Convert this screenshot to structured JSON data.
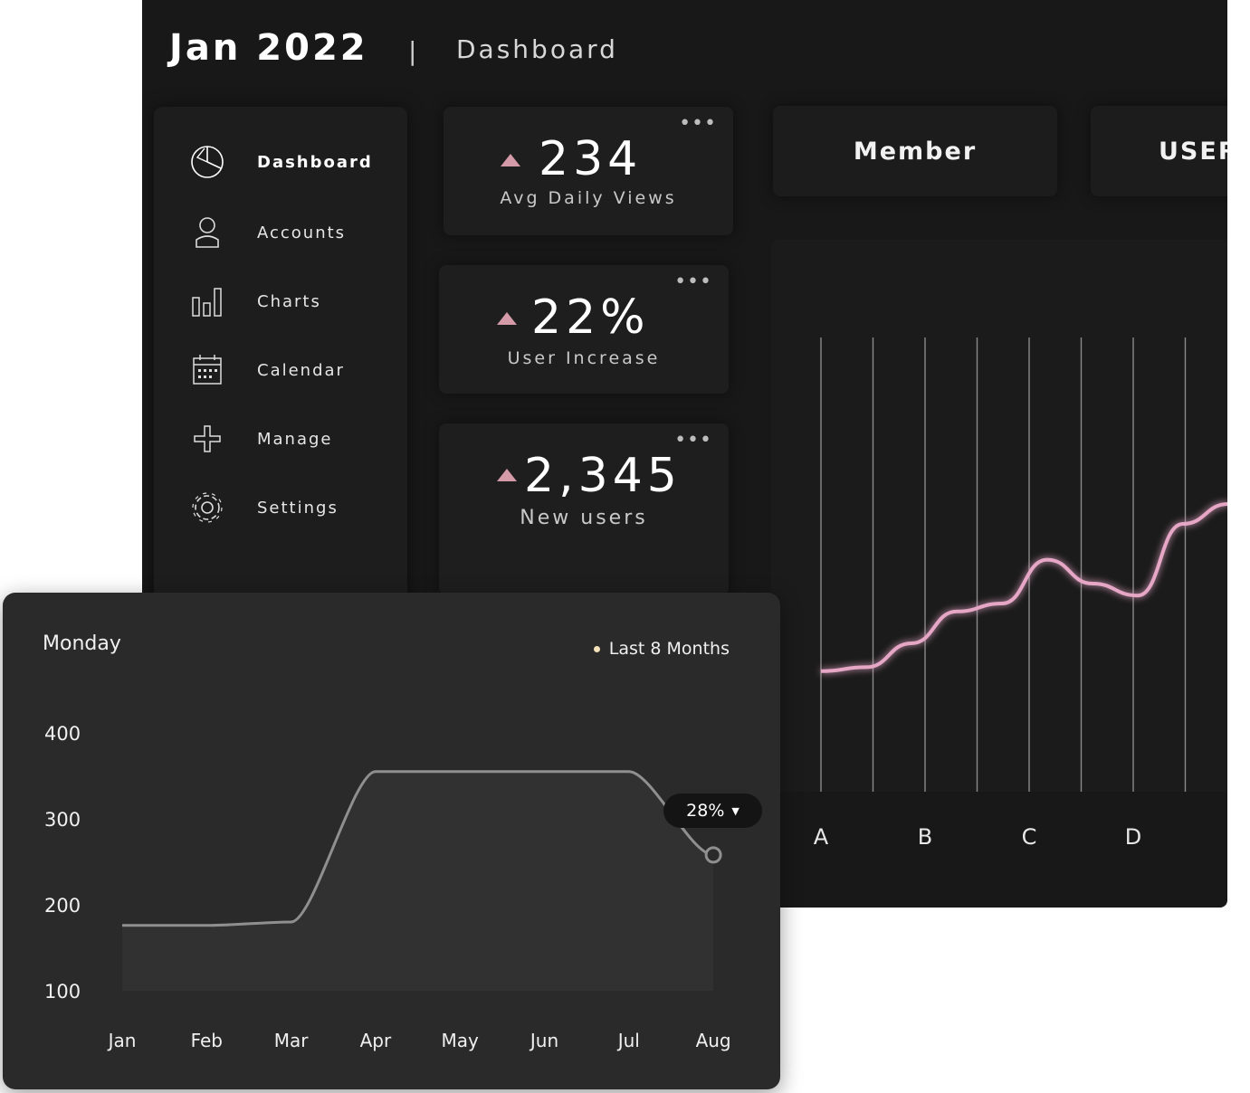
{
  "header": {
    "title": "Jan 2022",
    "separator": "|",
    "page": "Dashboard"
  },
  "sidebar": {
    "items": [
      {
        "label": "Dashboard",
        "icon": "pie-chart-icon",
        "active": true
      },
      {
        "label": "Accounts",
        "icon": "user-icon",
        "active": false
      },
      {
        "label": "Charts",
        "icon": "bar-chart-icon",
        "active": false
      },
      {
        "label": "Calendar",
        "icon": "calendar-icon",
        "active": false
      },
      {
        "label": "Manage",
        "icon": "plus-icon",
        "active": false
      },
      {
        "label": "Settings",
        "icon": "gear-icon",
        "active": false
      }
    ]
  },
  "stats": [
    {
      "value": "234",
      "label": "Avg Daily Views",
      "menu": "•••",
      "trend": "up"
    },
    {
      "value": "22%",
      "label": "User Increase",
      "menu": "•••",
      "trend": "up"
    },
    {
      "value": "2,345",
      "label": "New users",
      "menu": "•••",
      "trend": "up"
    }
  ],
  "top_buttons": {
    "member": "Member",
    "user": "USER"
  },
  "colors": {
    "accent_pink": "#d49aa8",
    "line_pink": "#e6a6c6",
    "background": "#181818",
    "card": "#2a2a2a",
    "legend_dot": "#f3e2b8"
  },
  "chart_data": [
    {
      "type": "line",
      "categories": [
        "A",
        "B",
        "C",
        "D"
      ],
      "series": [
        {
          "values": [
            0.06,
            0.08,
            0.2,
            0.36,
            0.4,
            0.62,
            0.5,
            0.44,
            0.8,
            0.9
          ]
        }
      ],
      "grid": "vertical",
      "xlabel": "",
      "ylabel": ""
    },
    {
      "type": "line",
      "title": "Monday",
      "legend": "Last 8 Months",
      "categories": [
        "Jan",
        "Feb",
        "Mar",
        "Apr",
        "May",
        "Jun",
        "Jul",
        "Aug"
      ],
      "series": [
        {
          "values": [
            176,
            176,
            180,
            355,
            355,
            355,
            355,
            258
          ]
        }
      ],
      "y_ticks": [
        400,
        300,
        200,
        100
      ],
      "ylim": [
        100,
        400
      ],
      "badge": "28%",
      "xlabel": "",
      "ylabel": ""
    }
  ]
}
